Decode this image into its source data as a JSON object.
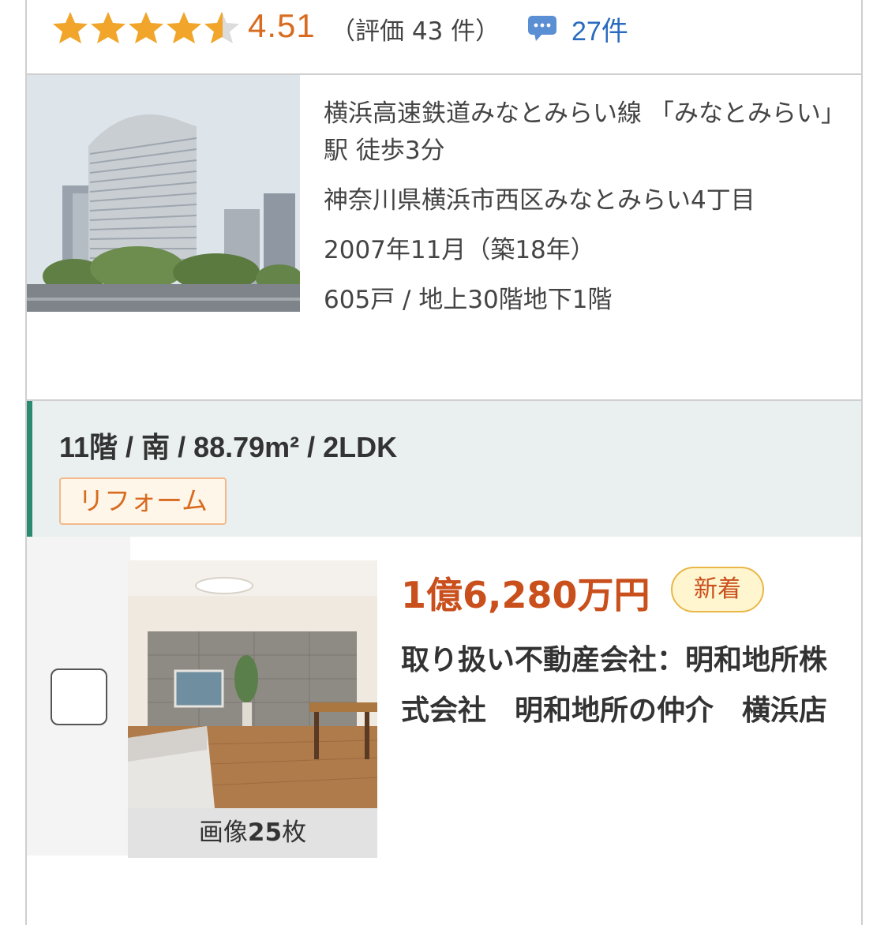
{
  "rating": {
    "stars_value": 4.51,
    "score": "4.51",
    "count_text": "（評価 43 件）",
    "review_count": "27件",
    "star_color": "#f1a52a",
    "star_empty_color": "#dcdcdc"
  },
  "building": {
    "access": "横浜高速鉄道みなとみらい線 「みなとみらい」駅 徒歩3分",
    "address": "神奈川県横浜市西区みなとみらい4丁目",
    "built": "2007年11月（築18年）",
    "units_floors": "605戸 / 地上30階地下1階"
  },
  "unit": {
    "title": "11階 / 南 / 88.79m² / 2LDK",
    "tag": "リフォーム"
  },
  "listing": {
    "photo_caption_prefix": "画像",
    "photo_count": "25",
    "photo_caption_suffix": "枚",
    "price": "1億6,280万円",
    "new_badge": "新着",
    "agent": "取り扱い不動産会社：明和地所株式会社　明和地所の仲介　横浜店",
    "accent_color": "#c94f1c"
  }
}
